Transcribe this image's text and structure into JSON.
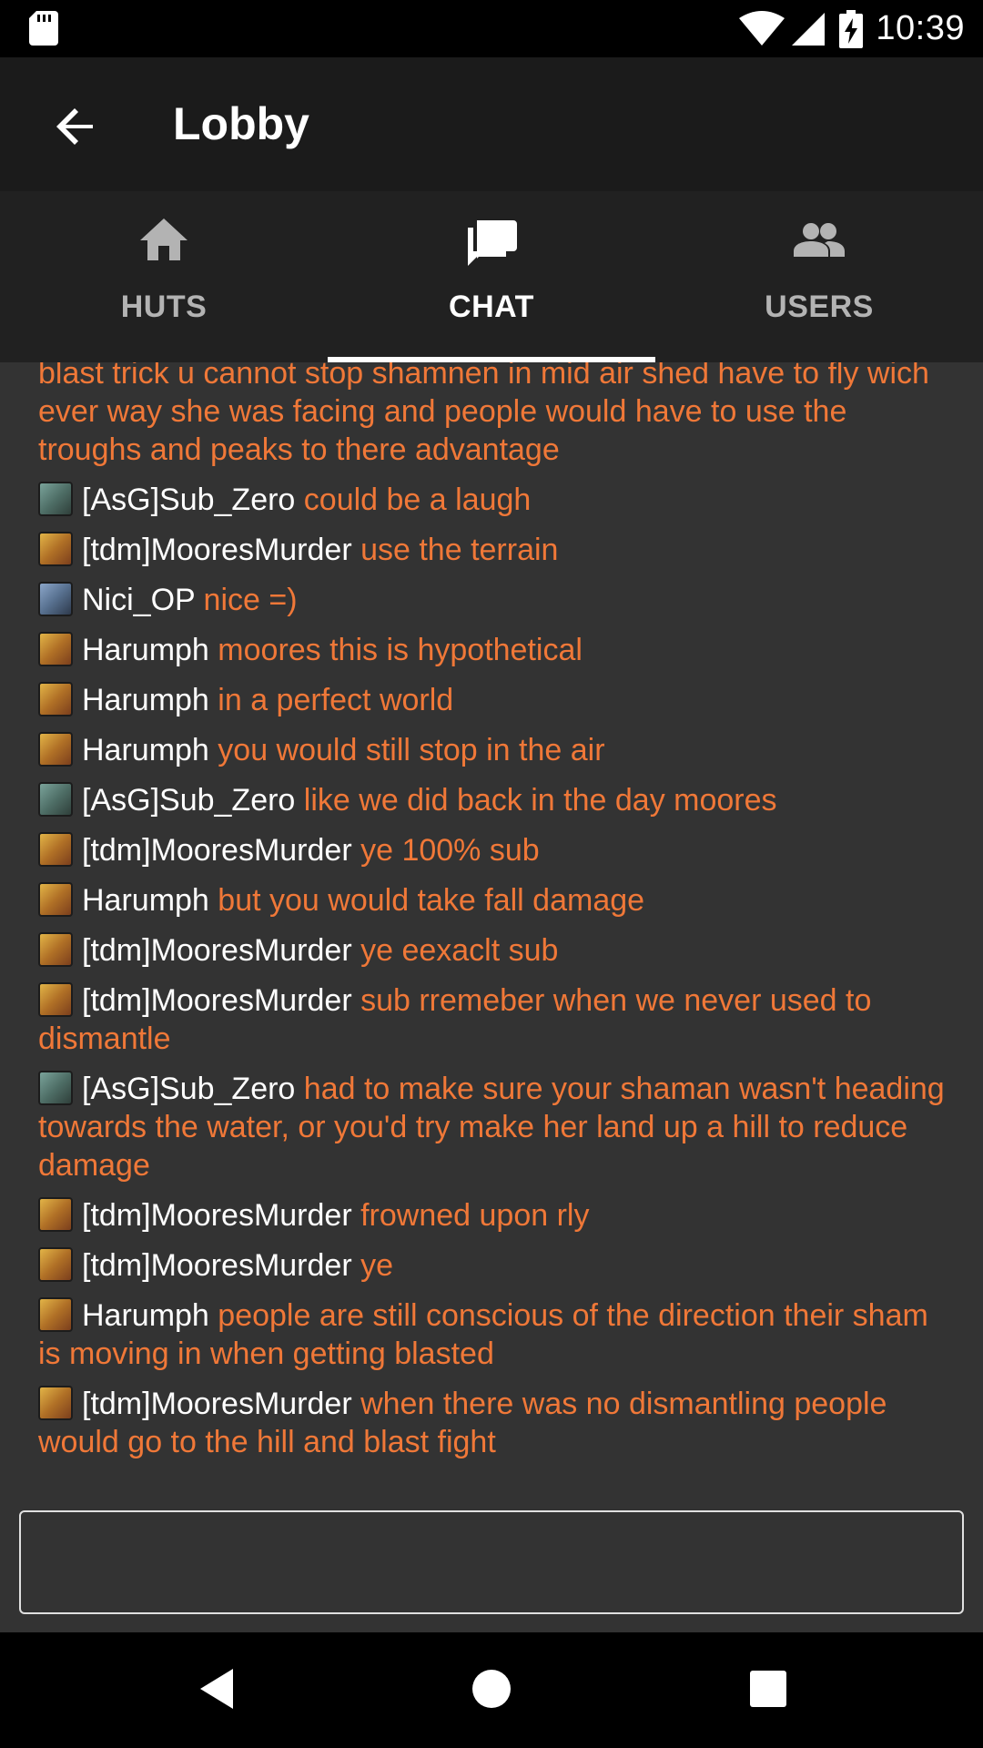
{
  "status_bar": {
    "time": "10:39",
    "icons": [
      "sd-card-icon",
      "wifi-icon",
      "cell-signal-icon",
      "battery-charging-icon"
    ]
  },
  "app_bar": {
    "title": "Lobby",
    "back_icon": "arrow-back-icon"
  },
  "tabs": [
    {
      "label": "HUTS",
      "icon": "home-icon",
      "active": false
    },
    {
      "label": "CHAT",
      "icon": "chat-icon",
      "active": true
    },
    {
      "label": "USERS",
      "icon": "people-icon",
      "active": false
    }
  ],
  "chat": {
    "partial_message": "blast trick u cannot stop shamnen in mid air shed have to fly wich ever way she was facing and people would have to use the troughs and peaks to there advantage",
    "messages": [
      {
        "user": "[AsG]Sub_Zero",
        "text": "could be a laugh"
      },
      {
        "user": "[tdm]MooresMurder",
        "text": "use the terrain"
      },
      {
        "user": "Nici_OP",
        "text": "nice =)"
      },
      {
        "user": "Harumph",
        "text": "moores this is hypothetical"
      },
      {
        "user": "Harumph",
        "text": "in a perfect world"
      },
      {
        "user": "Harumph",
        "text": "you would still stop in the air"
      },
      {
        "user": "[AsG]Sub_Zero",
        "text": "like we did back in the day moores"
      },
      {
        "user": "[tdm]MooresMurder",
        "text": "ye 100% sub"
      },
      {
        "user": "Harumph",
        "text": "but you would take fall damage"
      },
      {
        "user": "[tdm]MooresMurder",
        "text": "ye eexaclt sub"
      },
      {
        "user": "[tdm]MooresMurder",
        "text": "sub rremeber when we never used to dismantle"
      },
      {
        "user": "[AsG]Sub_Zero",
        "text": "had to make sure your shaman wasn't heading towards the water, or you'd try make her land up a hill to reduce damage"
      },
      {
        "user": "[tdm]MooresMurder",
        "text": "frowned upon rly"
      },
      {
        "user": "[tdm]MooresMurder",
        "text": "ye"
      },
      {
        "user": "Harumph",
        "text": "people are still conscious of the direction their sham is moving in when getting blasted"
      },
      {
        "user": "[tdm]MooresMurder",
        "text": "when there was no dismantling people would go to the hill and blast fight"
      }
    ]
  },
  "input": {
    "value": "",
    "placeholder": ""
  },
  "nav_bar": {
    "buttons": [
      "back-triangle-icon",
      "home-circle-icon",
      "recents-square-icon"
    ]
  },
  "colors": {
    "message_text": "#f07838",
    "username_text": "#ffffff",
    "chat_background": "#333333",
    "app_bar": "#1b1b1b",
    "tab_bar": "#212121"
  }
}
